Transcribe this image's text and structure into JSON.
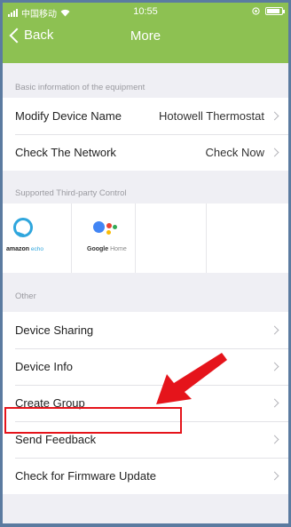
{
  "status_bar": {
    "carrier": "中国移动",
    "time": "10:55"
  },
  "nav": {
    "back_label": "Back",
    "title": "More"
  },
  "sections": {
    "basic_info": {
      "header": "Basic information of the equipment",
      "rows": [
        {
          "label": "Modify Device Name",
          "value": "Hotowell Thermostat"
        },
        {
          "label": "Check The Network",
          "value": "Check Now"
        }
      ]
    },
    "third_party": {
      "header": "Supported Third-party Control",
      "items": [
        {
          "icon": "amazon-echo-icon",
          "brand": "amazon",
          "product": "echo"
        },
        {
          "icon": "google-home-icon",
          "brand": "Google",
          "product": "Home"
        }
      ]
    },
    "other": {
      "header": "Other",
      "rows": [
        {
          "label": "Device Sharing"
        },
        {
          "label": "Device Info"
        },
        {
          "label": "Create Group"
        },
        {
          "label": "Send Feedback"
        },
        {
          "label": "Check for Firmware Update"
        }
      ]
    }
  },
  "colors": {
    "header_green": "#8dc152",
    "background": "#efeff4",
    "frame_blue": "#5b7ba0",
    "annotation_red": "#e5141b",
    "alexa_blue": "#2fa6dd"
  }
}
